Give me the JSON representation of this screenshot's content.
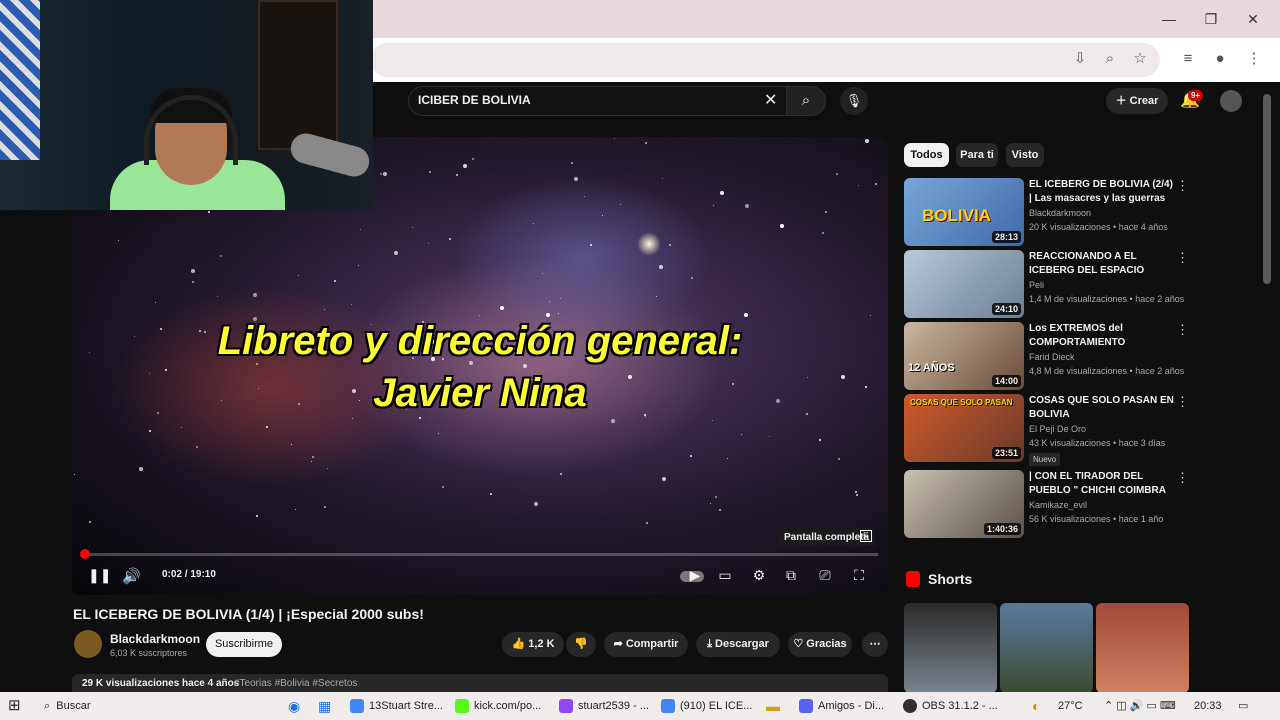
{
  "search": {
    "value": "ICIBER DE BOLIVIA"
  },
  "header": {
    "create_label": "Crear",
    "notif_badge": "9+"
  },
  "player": {
    "subtitle_line1": "Libreto y dirección general:",
    "subtitle_line2": "Javier Nina",
    "fullscreen_tooltip": "Pantalla completa",
    "fullscreen_key": "F",
    "time": "0:02 / 19:10",
    "progress_fraction": 0.0017
  },
  "video": {
    "title": "EL ICEBERG DE BOLIVIA (1/4) | ¡Especial 2000 subs!",
    "channel": "Blackdarkmoon",
    "subscribers": "6,03 K suscriptores",
    "subscribe_label": "Suscribirme",
    "likes": "1,2 K",
    "share_label": "Compartir",
    "download_label": "Descargar",
    "thanks_label": "Gracias",
    "views_date": "29 K visualizaciones  hace 4 años",
    "tags": "#Teorias #Bolivia #Secretos"
  },
  "chips": [
    "Todos",
    "Para ti",
    "Visto"
  ],
  "recommendations": [
    {
      "title": "EL ICEBERG DE BOLIVIA (2/4) | Las masacres y las guerras",
      "channel": "Blackdarkmoon",
      "meta": "20 K visualizaciones • hace 4 años",
      "duration": "28:13",
      "thumb_text": "BOLIVIA"
    },
    {
      "title": "REACCIONANDO A EL ICEBERG DEL ESPACIO",
      "channel": "Peli",
      "meta": "1,4 M de visualizaciones • hace 2 años",
      "duration": "24:10",
      "thumb_text": ""
    },
    {
      "title": "Los EXTREMOS del COMPORTAMIENTO HUMANO...",
      "channel": "Farid Dieck",
      "meta": "4,8 M de visualizaciones • hace 2 años",
      "duration": "14:00",
      "thumb_text": "12 AÑOS"
    },
    {
      "title": "COSAS QUE SOLO PASAN EN BOLIVIA",
      "channel": "El Peji De Oro",
      "meta": "43 K visualizaciones • hace 3 días",
      "duration": "23:51",
      "thumb_text": "COSAS QUE SOLO PASAN"
    },
    {
      "title": "| CON EL TIRADOR DEL PUEBLO \" CHICHI COIMBRA ...",
      "channel": "Kamikaze_evil",
      "meta": "56 K visualizaciones • hace 1 año",
      "duration": "1:40:36",
      "thumb_text": ""
    }
  ],
  "new_badge": "Nuevo",
  "shorts": {
    "title": "Shorts"
  },
  "taskbar": {
    "search_label": "Buscar",
    "apps": [
      "13Stuart Stre...",
      "kick.com/po...",
      "stuart2539 - ...",
      "(910) EL ICE...",
      "Amigos - Di...",
      "OBS 31.1.2 - ..."
    ],
    "temperature": "27°C",
    "clock": "20:33"
  },
  "colors": {
    "accent_red": "#ff0000",
    "subtitle_yellow": "#ffff33",
    "webcam_shirt": "#9ae698"
  }
}
